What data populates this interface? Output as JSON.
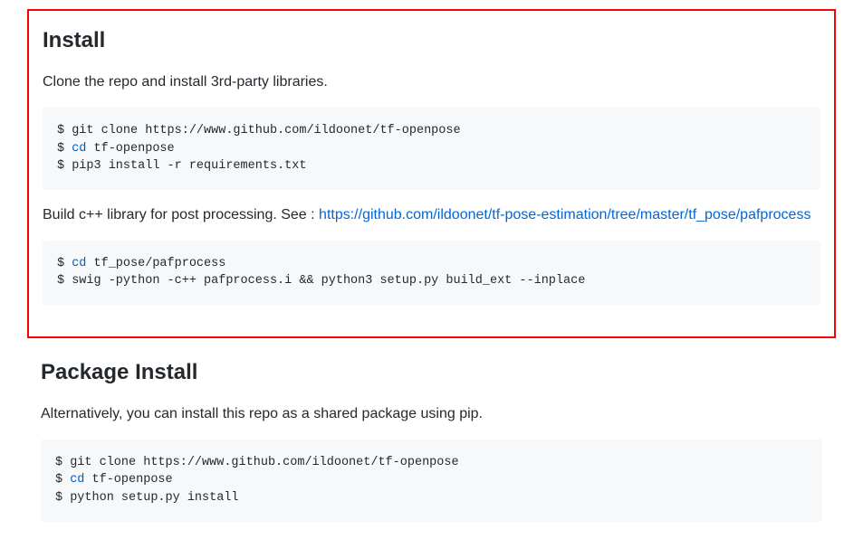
{
  "section1": {
    "heading": "Install",
    "intro": "Clone the repo and install 3rd-party libraries.",
    "code1": {
      "line1_prompt": "$ ",
      "line1_cmd": "git clone https://www.github.com/ildoonet/tf-openpose",
      "line2_prompt": "$ ",
      "line2_builtin": "cd",
      "line2_rest": " tf-openpose",
      "line3_prompt": "$ ",
      "line3_cmd": "pip3 install -r requirements.txt"
    },
    "para2_text": "Build c++ library for post processing. See : ",
    "para2_link": "https://github.com/ildoonet/tf-pose-estimation/tree/master/tf_pose/pafprocess",
    "code2": {
      "line1_prompt": "$ ",
      "line1_builtin": "cd",
      "line1_rest": " tf_pose/pafprocess",
      "line2_prompt": "$ ",
      "line2_cmd": "swig -python -c++ pafprocess.i && python3 setup.py build_ext --inplace"
    }
  },
  "section2": {
    "heading": "Package Install",
    "intro": "Alternatively, you can install this repo as a shared package using pip.",
    "code1": {
      "line1_prompt": "$ ",
      "line1_cmd": "git clone https://www.github.com/ildoonet/tf-openpose",
      "line2_prompt": "$ ",
      "line2_builtin": "cd",
      "line2_rest": " tf-openpose",
      "line3_prompt": "$ ",
      "line3_cmd": "python setup.py install"
    }
  }
}
